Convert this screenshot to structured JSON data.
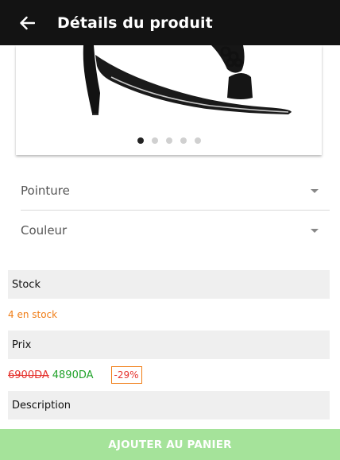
{
  "header": {
    "title": "Détails du produit",
    "back_icon": "arrow-left-icon"
  },
  "gallery": {
    "image": "black-high-heel-sandal",
    "dot_count": 5,
    "active_index": 0
  },
  "options": {
    "size_label": "Pointure",
    "color_label": "Couleur"
  },
  "stock": {
    "heading": "Stock",
    "value": "4 en stock"
  },
  "price": {
    "heading": "Prix",
    "old": "6900DA",
    "new": "4890DA",
    "discount": "-29%"
  },
  "description": {
    "heading": "Description"
  },
  "cart": {
    "button_label": "AJOUTER AU PANIER"
  },
  "colors": {
    "appbar": "#131313",
    "stock": "#f07c14",
    "old_price": "#e5322d",
    "new_price": "#22a32b",
    "cart_button": "#a5e39a"
  }
}
